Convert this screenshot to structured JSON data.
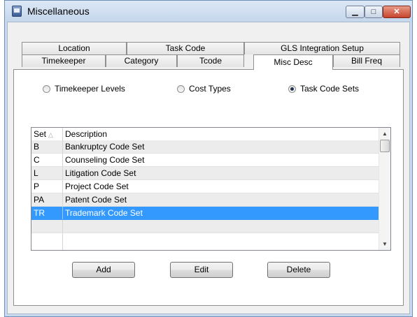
{
  "window": {
    "title": "Miscellaneous",
    "minimize_glyph": "▁",
    "maximize_glyph": "□",
    "close_glyph": "✕"
  },
  "tabs": {
    "row_top": [
      "Location",
      "Task Code",
      "GLS Integration Setup"
    ],
    "row_bottom": [
      "Timekeeper",
      "Category",
      "Tcode",
      "Misc Desc",
      "Bill Freq"
    ],
    "active": "Misc Desc"
  },
  "radio_options": [
    {
      "label": "Timekeeper Levels",
      "selected": false
    },
    {
      "label": "Cost Types",
      "selected": false
    },
    {
      "label": "Task Code Sets",
      "selected": true
    }
  ],
  "grid": {
    "columns": {
      "set": "Set",
      "description": "Description"
    },
    "sort_indicator": "△",
    "rows": [
      {
        "set": "B",
        "description": "Bankruptcy Code Set"
      },
      {
        "set": "C",
        "description": "Counseling Code Set"
      },
      {
        "set": "L",
        "description": "Litigation Code Set"
      },
      {
        "set": "P",
        "description": "Project Code Set"
      },
      {
        "set": "PA",
        "description": "Patent Code Set"
      },
      {
        "set": "TR",
        "description": "Trademark Code Set"
      }
    ],
    "selected_row": "TR",
    "scroll_up": "▲",
    "scroll_down": "▼"
  },
  "buttons": {
    "add": "Add",
    "edit": "Edit",
    "delete": "Delete"
  },
  "colors": {
    "selection": "#3399ff",
    "close_button": "#c6452d"
  }
}
